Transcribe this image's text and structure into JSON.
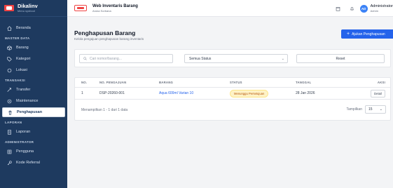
{
  "sidebar": {
    "brand_name": "Dikalinv",
    "brand_sub": "Menu sysfood",
    "items": {
      "beranda": "Beranda",
      "barang": "Barang",
      "kategori": "Kategori",
      "lokasi": "Lokasi",
      "transfer": "Transfer",
      "maintenance": "Maintenance",
      "penghapusan": "Penghapusan",
      "laporan": "Laporan",
      "pengguna": "Pengguna",
      "kode_referral": "Kode Referral"
    },
    "sections": {
      "master_data": "MASTER DATA",
      "transaksi": "TRANSAKSI",
      "laporan": "LAPORAN",
      "administrator": "ADMINISTRATOR"
    }
  },
  "topbar": {
    "title": "Web Inventaris Barang",
    "subtitle": "Aruka Sorbana",
    "avatar_initials": "AD",
    "user_name": "Administrator",
    "user_role": "Admin"
  },
  "page": {
    "title": "Penghapusan Barang",
    "subtitle": "Kelola pengajuan penghapusan barang inventaris",
    "add_button": "Ajukan Penghapusan"
  },
  "filters": {
    "search_placeholder": "Cari nomor/barang...",
    "status_selected": "Semua Status",
    "reset_label": "Reset"
  },
  "table": {
    "headers": {
      "no": "NO.",
      "no_pengajuan": "NO. PENGAJUAN",
      "barang": "BARANG",
      "status": "STATUS",
      "tanggal": "TANGGAL",
      "aksi": "AKSI"
    },
    "rows": [
      {
        "no": "1",
        "no_pengajuan": "DSP-20260-001",
        "barang": "Aqua 600ml Varian 10",
        "status": "Menunggu Persetujuan",
        "tanggal": "28 Jan 2026",
        "aksi": "Detail"
      }
    ],
    "footer_info": "Menampilkan 1 - 1 dari 1 data",
    "per_page_label": "Tampilkan",
    "per_page_value": "15"
  }
}
